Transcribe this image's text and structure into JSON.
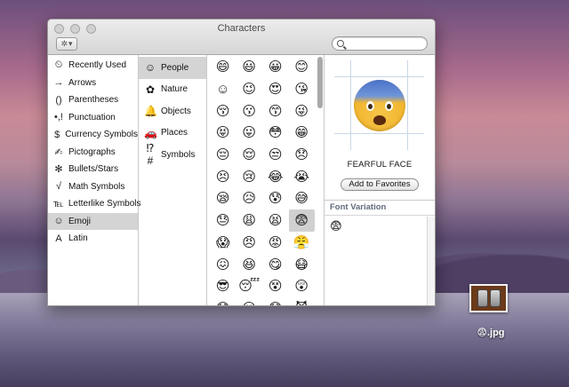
{
  "window": {
    "title": "Characters",
    "search": {
      "placeholder": "",
      "value": ""
    },
    "gear_icon": "gear-icon"
  },
  "categories": [
    {
      "label": "Recently Used",
      "icon": "⏲"
    },
    {
      "label": "Arrows",
      "icon": "→"
    },
    {
      "label": "Parentheses",
      "icon": "()"
    },
    {
      "label": "Punctuation",
      "icon": "•,!"
    },
    {
      "label": "Currency Symbols",
      "icon": "$"
    },
    {
      "label": "Pictographs",
      "icon": "✍"
    },
    {
      "label": "Bullets/Stars",
      "icon": "✻"
    },
    {
      "label": "Math Symbols",
      "icon": "√"
    },
    {
      "label": "Letterlike Symbols",
      "icon": "℡"
    },
    {
      "label": "Emoji",
      "icon": "☺"
    },
    {
      "label": "Latin",
      "icon": "A"
    }
  ],
  "selected_category": "Emoji",
  "subcategories": [
    {
      "label": "People",
      "icon": "☺"
    },
    {
      "label": "Nature",
      "icon": "✿"
    },
    {
      "label": "Objects",
      "icon": "🔔"
    },
    {
      "label": "Places",
      "icon": "🚗"
    },
    {
      "label": "Symbols",
      "icon": "⁉#"
    }
  ],
  "selected_subcategory": "People",
  "emoji_grid": [
    "😄",
    "😃",
    "😀",
    "😊",
    "☺",
    "😉",
    "😍",
    "😘",
    "😚",
    "😗",
    "😙",
    "😜",
    "😝",
    "😛",
    "😳",
    "😁",
    "😔",
    "😌",
    "😒",
    "😞",
    "😣",
    "😢",
    "😂",
    "😭",
    "😪",
    "😥",
    "😰",
    "😅",
    "😓",
    "😩",
    "😫",
    "😨",
    "😱",
    "😠",
    "😡",
    "😤",
    "😖",
    "😆",
    "😋",
    "😷",
    "😎",
    "😴",
    "😵",
    "😲",
    "😟",
    "😦",
    "😧",
    "😈"
  ],
  "selected_emoji_index": 31,
  "detail": {
    "character": "😨",
    "name": "FEARFUL FACE",
    "add_favorites_label": "Add to Favorites",
    "font_variation_label": "Font Variation",
    "variations": [
      "😨"
    ]
  },
  "desktop_file": {
    "label": "😨.jpg"
  }
}
